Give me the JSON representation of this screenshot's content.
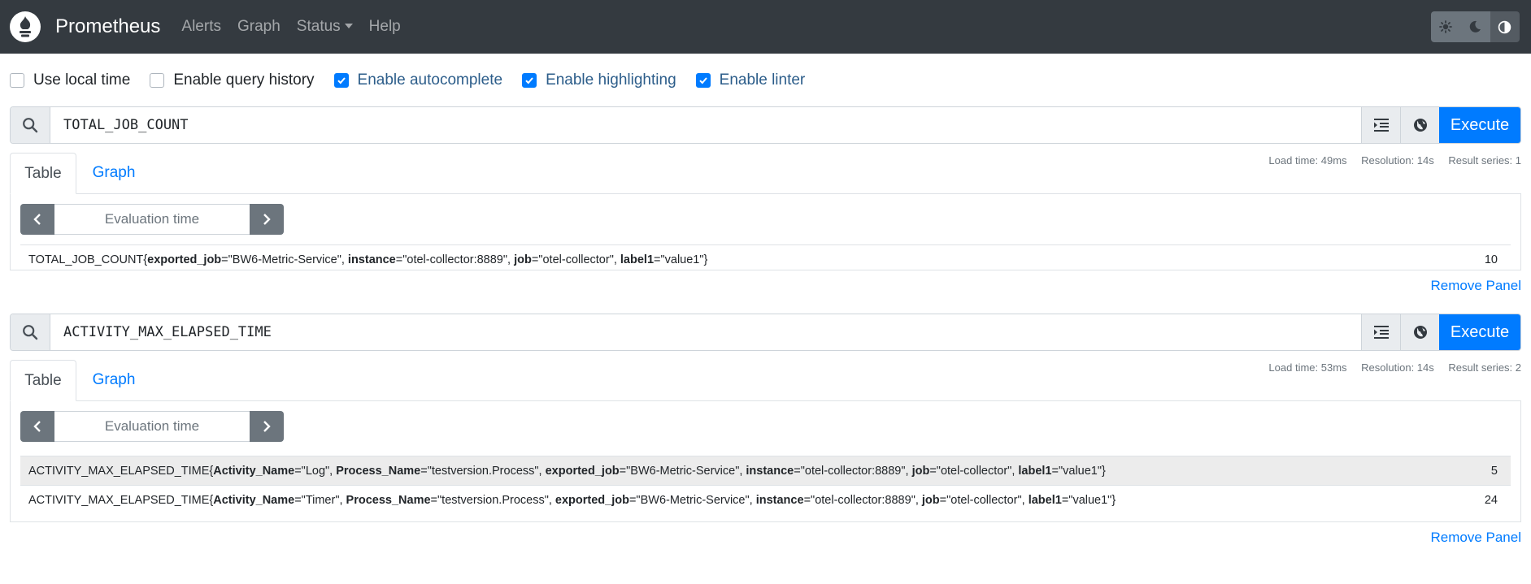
{
  "navbar": {
    "brand": "Prometheus",
    "links": [
      {
        "label": "Alerts"
      },
      {
        "label": "Graph"
      },
      {
        "label": "Status",
        "dropdown": true
      },
      {
        "label": "Help"
      }
    ],
    "theme_buttons": [
      {
        "icon": "sun-icon",
        "active": false
      },
      {
        "icon": "moon-icon",
        "active": false
      },
      {
        "icon": "adjust-icon",
        "active": true
      }
    ]
  },
  "options": [
    {
      "label": "Use local time",
      "checked": false
    },
    {
      "label": "Enable query history",
      "checked": false
    },
    {
      "label": "Enable autocomplete",
      "checked": true
    },
    {
      "label": "Enable highlighting",
      "checked": true
    },
    {
      "label": "Enable linter",
      "checked": true
    }
  ],
  "panels": [
    {
      "query": "TOTAL_JOB_COUNT",
      "execute_label": "Execute",
      "stats": {
        "load_time": "Load time: 49ms",
        "resolution": "Resolution: 14s",
        "result_series": "Result series: 1"
      },
      "tabs": [
        "Table",
        "Graph"
      ],
      "eval_placeholder": "Evaluation time",
      "rows": [
        {
          "metric_name": "TOTAL_JOB_COUNT",
          "labels": [
            {
              "key": "exported_job",
              "value": "BW6-Metric-Service"
            },
            {
              "key": "instance",
              "value": "otel-collector:8889"
            },
            {
              "key": "job",
              "value": "otel-collector"
            },
            {
              "key": "label1",
              "value": "value1"
            }
          ],
          "value": "10"
        }
      ],
      "remove_label": "Remove Panel"
    },
    {
      "query": "ACTIVITY_MAX_ELAPSED_TIME",
      "execute_label": "Execute",
      "stats": {
        "load_time": "Load time: 53ms",
        "resolution": "Resolution: 14s",
        "result_series": "Result series: 2"
      },
      "tabs": [
        "Table",
        "Graph"
      ],
      "eval_placeholder": "Evaluation time",
      "rows": [
        {
          "metric_name": "ACTIVITY_MAX_ELAPSED_TIME",
          "labels": [
            {
              "key": "Activity_Name",
              "value": "Log"
            },
            {
              "key": "Process_Name",
              "value": "testversion.Process"
            },
            {
              "key": "exported_job",
              "value": "BW6-Metric-Service"
            },
            {
              "key": "instance",
              "value": "otel-collector:8889"
            },
            {
              "key": "job",
              "value": "otel-collector"
            },
            {
              "key": "label1",
              "value": "value1"
            }
          ],
          "value": "5"
        },
        {
          "metric_name": "ACTIVITY_MAX_ELAPSED_TIME",
          "labels": [
            {
              "key": "Activity_Name",
              "value": "Timer"
            },
            {
              "key": "Process_Name",
              "value": "testversion.Process"
            },
            {
              "key": "exported_job",
              "value": "BW6-Metric-Service"
            },
            {
              "key": "instance",
              "value": "otel-collector:8889"
            },
            {
              "key": "job",
              "value": "otel-collector"
            },
            {
              "key": "label1",
              "value": "value1"
            }
          ],
          "value": "24"
        }
      ],
      "remove_label": "Remove Panel"
    }
  ],
  "colors": {
    "navbar_bg": "#343a40",
    "primary": "#007bff",
    "secondary": "#6c757d"
  }
}
